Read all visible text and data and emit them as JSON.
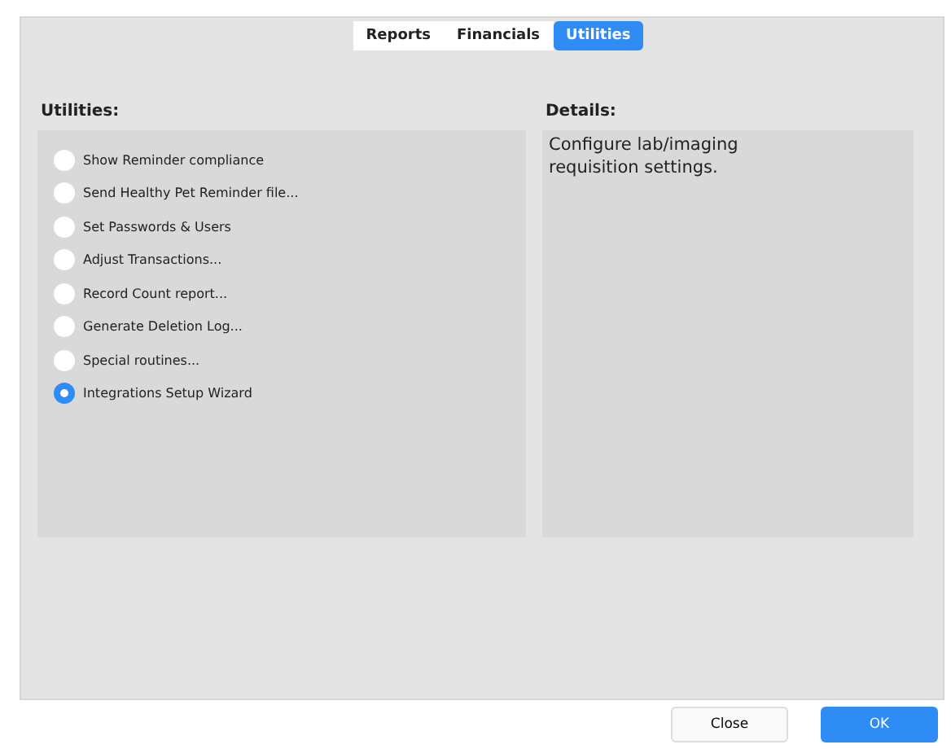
{
  "tabs": [
    {
      "label": "Reports",
      "selected": false
    },
    {
      "label": "Financials",
      "selected": false
    },
    {
      "label": "Utilities",
      "selected": true
    }
  ],
  "utilities": {
    "title": "Utilities:",
    "options": [
      {
        "label": "Show Reminder compliance",
        "selected": false
      },
      {
        "label": "Send Healthy Pet Reminder file...",
        "selected": false
      },
      {
        "label": "Set Passwords & Users",
        "selected": false
      },
      {
        "label": "Adjust Transactions...",
        "selected": false
      },
      {
        "label": "Record Count report...",
        "selected": false
      },
      {
        "label": "Generate Deletion Log...",
        "selected": false
      },
      {
        "label": "Special routines...",
        "selected": false
      },
      {
        "label": "Integrations Setup Wizard",
        "selected": true
      }
    ]
  },
  "details": {
    "title": "Details:",
    "text": "Configure lab/imaging requisition settings."
  },
  "buttons": [
    {
      "label": "Close",
      "kind": "normal"
    },
    {
      "label": "OK",
      "kind": "default"
    }
  ]
}
